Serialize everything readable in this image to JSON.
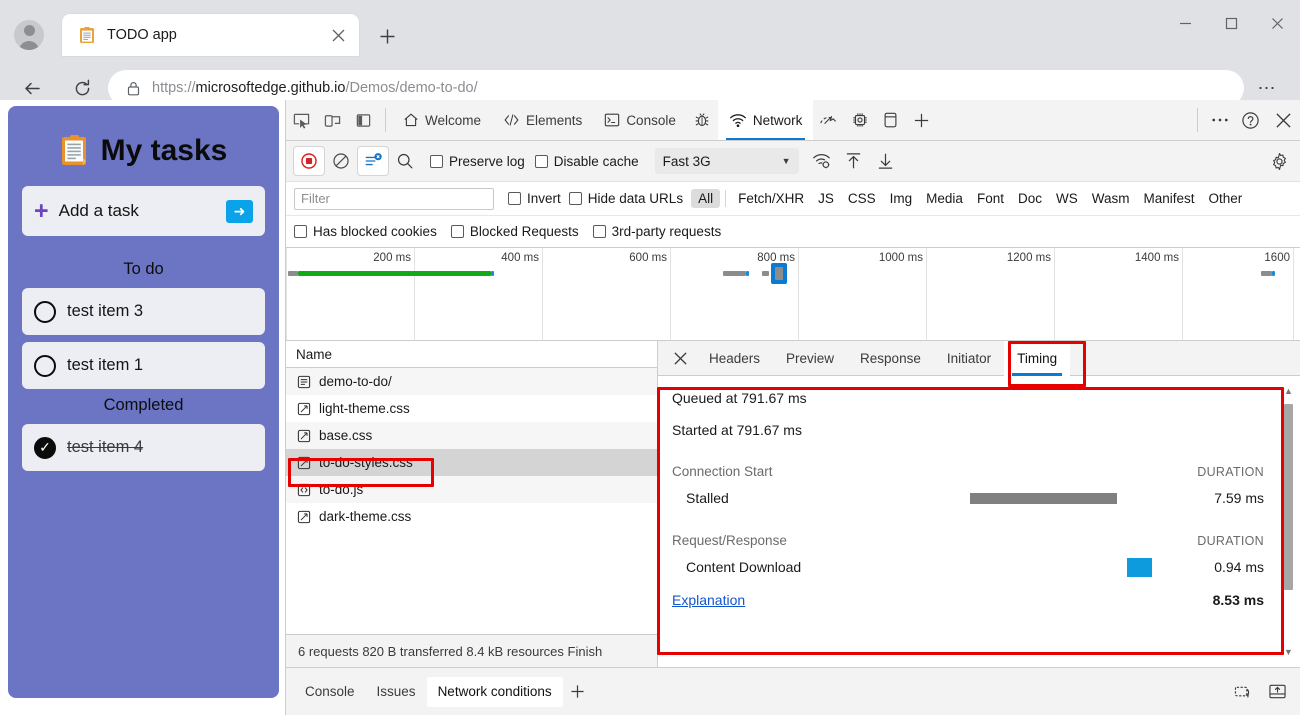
{
  "browser": {
    "tab": {
      "title": "TODO app",
      "favicon": "clipboard-icon"
    },
    "new_tab_label": "+",
    "url_secure": "https://",
    "url_host": "microsoftedge.github.io",
    "url_path": "/Demos/demo-to-do/",
    "url_full": "https://microsoftedge.github.io/Demos/demo-to-do/",
    "window_controls": {
      "minimize": "—",
      "maximize": "▢",
      "close": "✕"
    },
    "settings_label": "…"
  },
  "todo": {
    "title": "My tasks",
    "add_task": {
      "placeholder": "Add a task",
      "plus": "+",
      "submit": "➜"
    },
    "sections": [
      {
        "label": "To do",
        "items": [
          {
            "text": "test item 3",
            "done": false
          },
          {
            "text": "test item 1",
            "done": false
          }
        ]
      },
      {
        "label": "Completed",
        "items": [
          {
            "text": "test item 4",
            "done": true
          }
        ]
      }
    ]
  },
  "devtools": {
    "panel_tabs": [
      {
        "label": "Welcome",
        "icon": "home-icon",
        "active": false
      },
      {
        "label": "Elements",
        "icon": "code-brackets-icon",
        "active": false
      },
      {
        "label": "Console",
        "icon": "console-prompt-icon",
        "active": false
      },
      {
        "label": "Network",
        "icon": "wifi-icon",
        "active": true
      }
    ],
    "tab_icons_only": [
      "bug-icon",
      "performance-gauge-icon",
      "memory-chip-icon",
      "application-storage-icon",
      "add-panel-icon"
    ],
    "device_icons": [
      "inspect-element-icon",
      "device-emulation-icon",
      "dock-side-icon"
    ],
    "right_icons": [
      "more-options-icon",
      "help-icon",
      "close-devtools-icon"
    ],
    "toolbar": {
      "record_label": "record-stop-icon",
      "clear_label": "clear-icon",
      "filter_toggle_label": "filter-settings-icon",
      "search_label": "search-icon",
      "preserve_log": "Preserve log",
      "disable_cache": "Disable cache",
      "throttle_value": "Fast 3G",
      "throttle_caret": "▼",
      "extra_icons": [
        "network-conditions-icon",
        "import-har-icon",
        "export-har-icon"
      ],
      "settings_icon": "gear-icon"
    },
    "filterbar": {
      "filter_placeholder": "Filter",
      "invert": "Invert",
      "hide_data_urls": "Hide data URLs",
      "types": [
        "All",
        "Fetch/XHR",
        "JS",
        "CSS",
        "Img",
        "Media",
        "Font",
        "Doc",
        "WS",
        "Wasm",
        "Manifest",
        "Other"
      ],
      "active_type": "All"
    },
    "filterbar2": {
      "has_blocked_cookies": "Has blocked cookies",
      "blocked_requests": "Blocked Requests",
      "third_party_requests": "3rd-party requests"
    },
    "overview": {
      "ticks": [
        "200 ms",
        "400 ms",
        "600 ms",
        "800 ms",
        "1000 ms",
        "1200 ms",
        "1400 ms",
        "1600"
      ],
      "colors": {
        "green": "#14a916",
        "blue": "#1a8cd8",
        "gray": "#8c8c8c",
        "highlight": "#0b7ad1"
      }
    },
    "requests": {
      "column_name": "Name",
      "rows": [
        {
          "name": "demo-to-do/",
          "icon": "document-icon",
          "selected": false
        },
        {
          "name": "light-theme.css",
          "icon": "stylesheet-icon",
          "selected": false
        },
        {
          "name": "base.css",
          "icon": "stylesheet-icon",
          "selected": false
        },
        {
          "name": "to-do-styles.css",
          "icon": "stylesheet-icon",
          "selected": true
        },
        {
          "name": "to-do.js",
          "icon": "script-icon",
          "selected": false
        },
        {
          "name": "dark-theme.css",
          "icon": "stylesheet-icon",
          "selected": false
        }
      ],
      "status": "6 requests  820 B transferred  8.4 kB resources  Finish"
    },
    "details": {
      "close_icon": "close-icon",
      "tabs": [
        "Headers",
        "Preview",
        "Response",
        "Initiator",
        "Timing"
      ],
      "active_tab": "Timing",
      "timing": {
        "queued_at": "Queued at 791.67 ms",
        "started_at": "Started at 791.67 ms",
        "groups": [
          {
            "name": "Connection Start",
            "duration_header": "DURATION",
            "rows": [
              {
                "label": "Stalled",
                "duration": "7.59 ms",
                "bar_color": "#808080",
                "bar_left_pct": 34,
                "bar_width_pct": 44
              }
            ]
          },
          {
            "name": "Request/Response",
            "duration_header": "DURATION",
            "rows": [
              {
                "label": "Content Download",
                "duration": "0.94 ms",
                "bar_color": "#0e9bdd",
                "bar_left_pct": 80,
                "bar_width_pct": 7
              }
            ]
          }
        ],
        "explanation_link": "Explanation",
        "total": "8.53 ms"
      }
    },
    "drawer": {
      "tabs": [
        "Console",
        "Issues",
        "Network conditions"
      ],
      "active_tab": "Network conditions",
      "add_label": "+",
      "right_icons": [
        "screenshot-icon",
        "dock-drawer-icon"
      ]
    }
  },
  "annotations": {
    "accent_red": "#e60000",
    "boxes": [
      "timing-tab-highlight",
      "timing-panel-highlight",
      "selected-request-highlight"
    ]
  }
}
